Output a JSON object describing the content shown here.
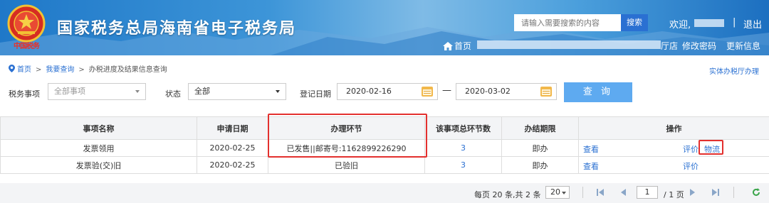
{
  "header": {
    "site_title": "国家税务总局海南省电子税务局",
    "emblem_text": "中国税务",
    "search_placeholder": "请输入需要搜索的内容",
    "search_button": "搜索",
    "welcome": "欢迎,",
    "logout": "退出",
    "home": "首页",
    "hall_suffix": "厅店",
    "change_password": "修改密码",
    "update_info": "更新信息"
  },
  "breadcrumb": {
    "items": [
      "首页",
      "我要查询",
      "办税进度及结果信息查询"
    ]
  },
  "physical_hall_link": "实体办税厅办理",
  "filters": {
    "tax_item_label": "税务事项",
    "tax_item_value": "全部事项",
    "status_label": "状态",
    "status_value": "全部",
    "date_label": "登记日期",
    "date_start": "2020-02-16",
    "date_separator": "—",
    "date_end": "2020-03-02",
    "query_button": "查 询"
  },
  "table": {
    "columns": [
      "事项名称",
      "申请日期",
      "办理环节",
      "该事项总环节数",
      "办结期限",
      "操作"
    ],
    "rows": [
      {
        "name": "发票领用",
        "date": "2020-02-25",
        "stage": "已发售||邮寄号:1162899226290",
        "steps": "3",
        "deadline": "即办",
        "view": "查看",
        "rate": "评价",
        "logistics": "物流"
      },
      {
        "name": "发票验(交)旧",
        "date": "2020-02-25",
        "stage": "已验旧",
        "steps": "3",
        "deadline": "即办",
        "view": "查看",
        "rate": "评价"
      }
    ]
  },
  "pager": {
    "info": "每页 20 条,共 2 条",
    "page_size": "20",
    "current_page": "1",
    "total_pages": "/ 1 页"
  },
  "colors": {
    "header_blue": "#1f78c8",
    "link_blue": "#2a70d2",
    "query_button": "#5eaaf0",
    "highlight_red": "#e3302e"
  },
  "icons": [
    "national-emblem",
    "home-icon",
    "location-pin-icon",
    "calendar-icon",
    "first-page-icon",
    "prev-page-icon",
    "next-page-icon",
    "last-page-icon",
    "refresh-icon"
  ]
}
